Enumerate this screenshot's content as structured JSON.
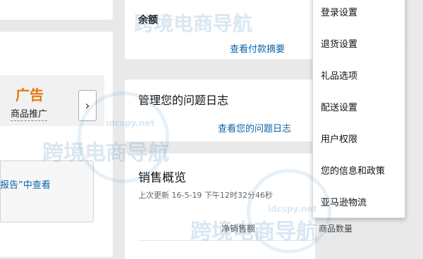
{
  "left": {
    "ad_title": "广告",
    "ad_subtitle": "商品推广",
    "ad_next_icon": "chevron-right-icon",
    "report_text": "报告”中查看"
  },
  "balance": {
    "label": "余额",
    "link": "查看付款摘要"
  },
  "issues": {
    "title": "管理您的问题日志",
    "link": "查看您的问题日志"
  },
  "sales": {
    "title": "销售概览",
    "updated": "上次更新 16-5-19 下午12时32分46秒",
    "col_net_sales": "净销售额",
    "col_units": "商品数量"
  },
  "menu": {
    "items": [
      {
        "label": "登录设置"
      },
      {
        "label": "退货设置"
      },
      {
        "label": "礼品选项"
      },
      {
        "label": "配送设置"
      },
      {
        "label": "用户权限"
      },
      {
        "label": "您的信息和政策"
      },
      {
        "label": "亚马逊物流"
      }
    ]
  },
  "watermark": {
    "text": "跨境电商导航",
    "url": "idcspy.net"
  },
  "colors": {
    "link": "#0a63a8",
    "ad_accent": "#e47911",
    "background": "#e9e9e9"
  }
}
